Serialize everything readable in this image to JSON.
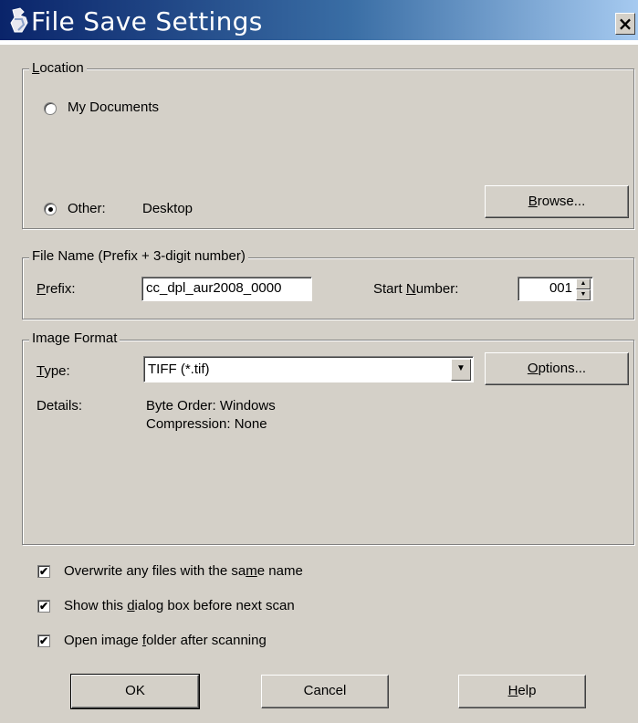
{
  "window": {
    "title": "File Save Settings",
    "icon": "scanner-hand-icon",
    "close_glyph": "×"
  },
  "location": {
    "legend": "Location",
    "legend_accel": "L",
    "legend_rest": "ocation",
    "my_documents_label": "My Documents",
    "my_documents_selected": false,
    "other_label": "Other:",
    "other_selected": true,
    "other_value": "Desktop",
    "browse": {
      "accel": "B",
      "rest": "rowse..."
    }
  },
  "file_name": {
    "legend": "File Name (Prefix + 3-digit number)",
    "prefix_accel": "P",
    "prefix_rest": "refix:",
    "prefix_value": "cc_dpl_aur2008_0000",
    "start_pre": "Start ",
    "start_accel": "N",
    "start_post": "umber:",
    "start_value": "001"
  },
  "image_format": {
    "legend": "Image Format",
    "type_accel": "T",
    "type_rest": "ype:",
    "type_value": "TIFF (*.tif)",
    "options": {
      "accel": "O",
      "rest": "ptions..."
    },
    "details_label": "Details:",
    "details": [
      "Byte Order: Windows",
      "Compression: None"
    ]
  },
  "checkboxes": [
    {
      "pre": "Overwrite any files with the sa",
      "accel": "m",
      "post": "e name",
      "checked": true
    },
    {
      "pre": "Show this ",
      "accel": "d",
      "post": "ialog box before next scan",
      "checked": true
    },
    {
      "pre": "Open image ",
      "accel": "f",
      "post": "older after scanning",
      "checked": true
    }
  ],
  "buttons": {
    "ok": "OK",
    "cancel": "Cancel",
    "help_accel": "H",
    "help_rest": "elp"
  },
  "check_glyph": "✔"
}
